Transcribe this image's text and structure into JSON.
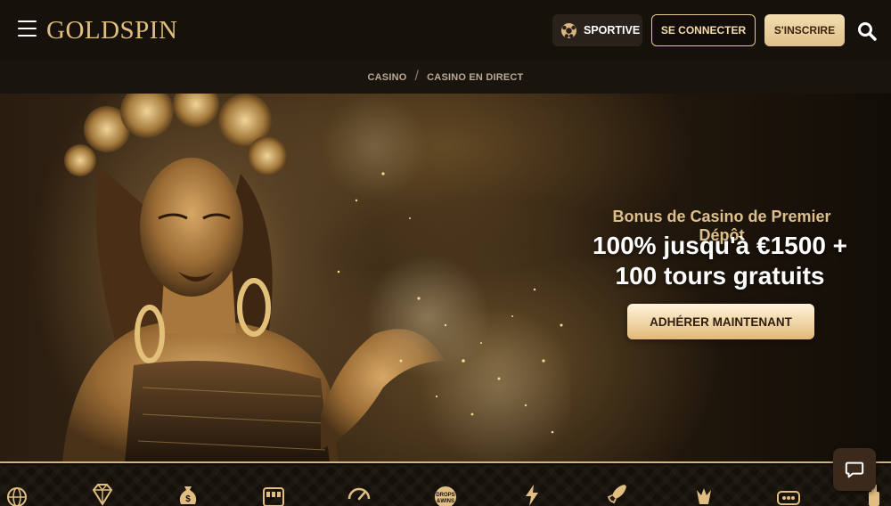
{
  "header": {
    "logo_text_left": "GOLD",
    "logo_text_right": "SPIN",
    "sport_label": "SPORTIVE",
    "login_label": "SE CONNECTER",
    "register_label": "S'INSCRIRE"
  },
  "breadcrumb": {
    "items": [
      "CASINO",
      "CASINO EN DIRECT"
    ],
    "separator": "/"
  },
  "hero": {
    "eyebrow": "Bonus de Casino de Premier Dépôt",
    "headline_line1": "100% jusqu'à €1500 +",
    "headline_line2": "100 tours gratuits",
    "cta_label": "ADHÉRER MAINTENANT"
  },
  "categories": {
    "icons": [
      "globe-icon",
      "diamond-icon",
      "money-bag-icon",
      "slot-machine-icon",
      "speedometer-icon",
      "drops-wins-icon",
      "lightning-icon",
      "rocket-icon",
      "crown-cards-icon",
      "keno-icon",
      "bottle-icon"
    ],
    "drops_wins_text": "DROPS & WINS"
  },
  "colors": {
    "accent_gold": "#e0bd80",
    "header_bg": "#17110b",
    "cta_gold": "#efd4a4"
  }
}
